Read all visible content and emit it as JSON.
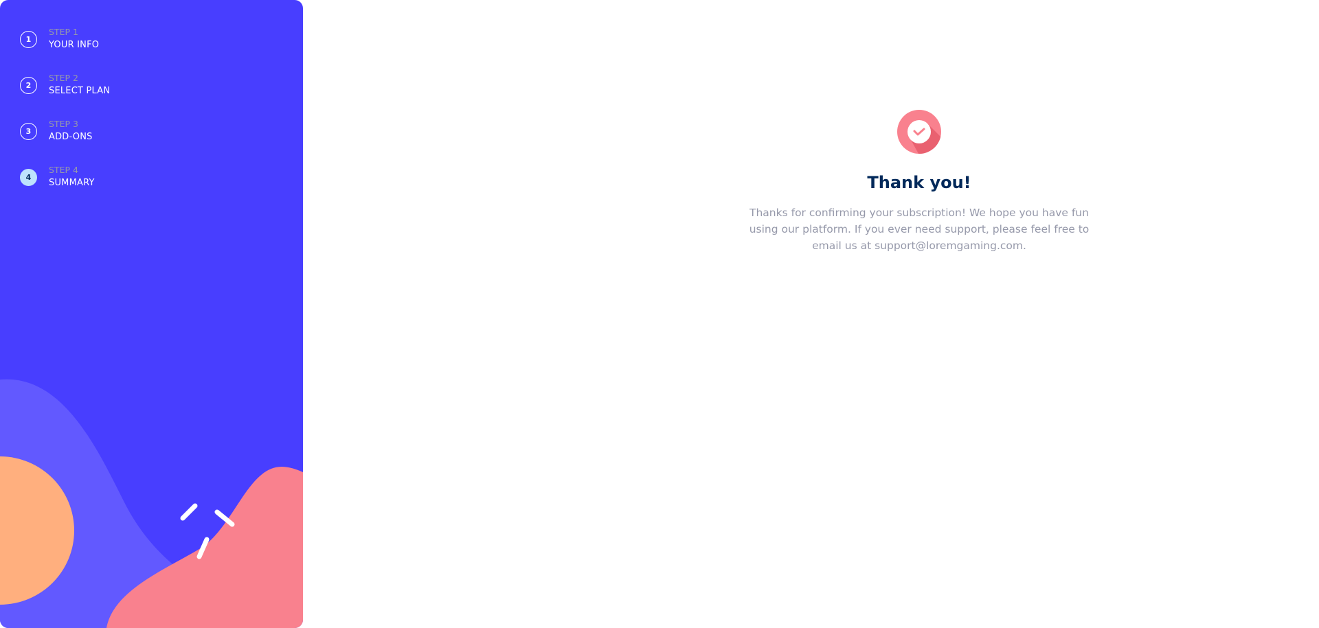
{
  "sidebar": {
    "steps": [
      {
        "number": "1",
        "label": "STEP 1",
        "title": "YOUR INFO",
        "active": false
      },
      {
        "number": "2",
        "label": "STEP 2",
        "title": "SELECT PLAN",
        "active": false
      },
      {
        "number": "3",
        "label": "STEP 3",
        "title": "ADD-ONS",
        "active": false
      },
      {
        "number": "4",
        "label": "STEP 4",
        "title": "SUMMARY",
        "active": true
      }
    ]
  },
  "main": {
    "icon": "checkmark-circle-icon",
    "title": "Thank you!",
    "message": "Thanks for confirming your subscription! We hope you have fun using our platform. If you ever need support, please feel free to email us at support@loremgaming.com."
  },
  "colors": {
    "sidebar": "#483eff",
    "accent_pink": "#f9818e",
    "orange": "#ffaf7e",
    "title": "#02295a",
    "text": "#9699aa"
  }
}
